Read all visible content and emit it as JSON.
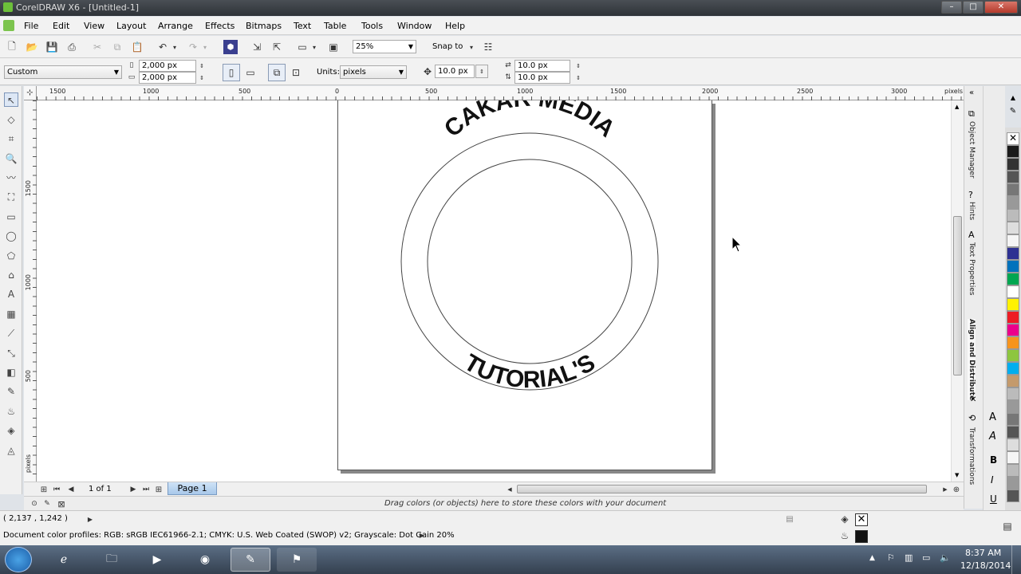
{
  "window": {
    "title": "CorelDRAW X6 - [Untitled-1]"
  },
  "menu": [
    "File",
    "Edit",
    "View",
    "Layout",
    "Arrange",
    "Effects",
    "Bitmaps",
    "Text",
    "Table",
    "Tools",
    "Window",
    "Help"
  ],
  "toolbar": {
    "zoom": "25%",
    "snap_to": "Snap to"
  },
  "property_bar": {
    "preset": "Custom",
    "width": "2,000 px",
    "height": "2,000 px",
    "units_label": "Units:",
    "units": "pixels",
    "nudge": "10.0 px",
    "dup_x": "10.0 px",
    "dup_y": "10.0 px"
  },
  "ruler": {
    "h_ticks": [
      "1500",
      "1000",
      "500",
      "0",
      "500",
      "1000",
      "1500",
      "2000",
      "2500",
      "3000"
    ],
    "h_unit": "pixels",
    "v_ticks": [
      "1500",
      "1000",
      "500"
    ],
    "v_unit": "pixels"
  },
  "artwork": {
    "top_text": "CAKAR MEDIA",
    "bottom_text": "TUTORIAL'S"
  },
  "page_nav": {
    "count": "1 of 1",
    "tab": "Page 1"
  },
  "dockers": [
    "Object Manager",
    "Hints",
    "Text Properties",
    "Align and Distribute",
    "Transformations"
  ],
  "color_tray": {
    "hint": "Drag colors (or objects) here to store these colors with your document"
  },
  "status": {
    "coords": "( 2,137 , 1,242 )",
    "profiles": "Document color profiles: RGB: sRGB IEC61966-2.1; CMYK: U.S. Web Coated (SWOP) v2; Grayscale: Dot Gain 20%"
  },
  "palette_colors": [
    "#ffffff",
    "#1a1a1a",
    "#333333",
    "#555555",
    "#777777",
    "#999999",
    "#bbbbbb",
    "#dddddd",
    "#f5f5f5",
    "#2e3192",
    "#0072bc",
    "#00a651",
    "#fff200",
    "#ed1c24",
    "#ec008c",
    "#f7941d",
    "#8dc63f",
    "#00aeef",
    "#c49a6c"
  ],
  "clock": {
    "time": "8:37 AM",
    "date": "12/18/2014"
  }
}
